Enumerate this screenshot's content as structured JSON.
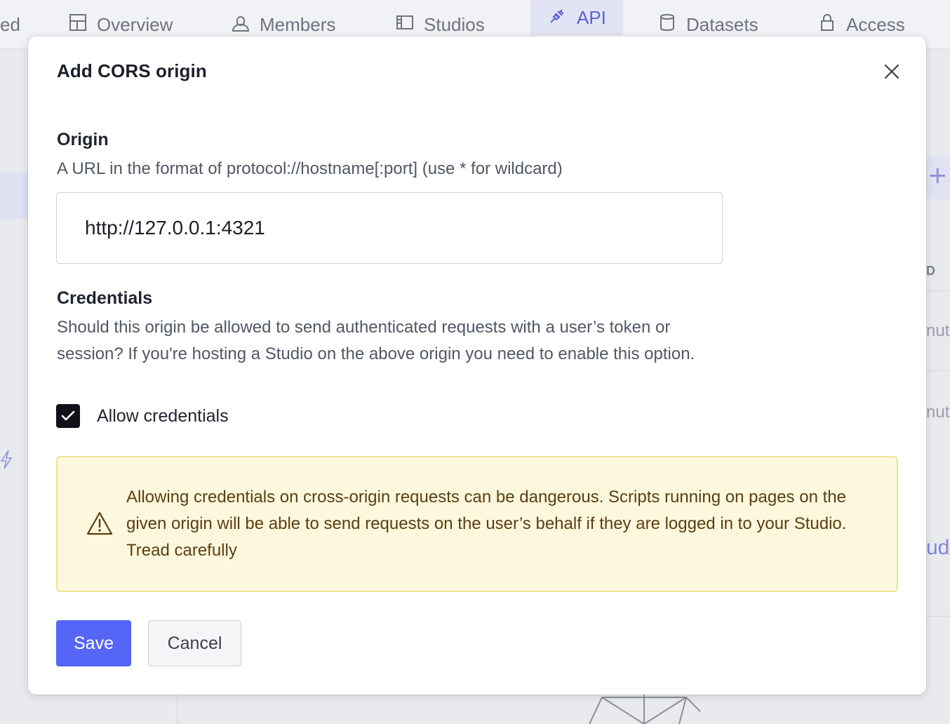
{
  "nav": {
    "tabs": [
      {
        "label": "ed",
        "icon": "none"
      },
      {
        "label": "Overview",
        "icon": "layout-icon"
      },
      {
        "label": "Members",
        "icon": "users-icon"
      },
      {
        "label": "Studios",
        "icon": "studio-icon"
      },
      {
        "label": "API",
        "icon": "plug-icon",
        "active": true
      },
      {
        "label": "Datasets",
        "icon": "database-icon"
      },
      {
        "label": "Access",
        "icon": "lock-icon"
      }
    ]
  },
  "background": {
    "right_column_header": "D",
    "right_row_1": "nute",
    "right_row_2": "nute",
    "right_link": "udi"
  },
  "modal": {
    "title": "Add CORS origin",
    "origin": {
      "label": "Origin",
      "description": "A URL in the format of protocol://hostname[:port] (use * for wildcard)",
      "value": "http://127.0.0.1:4321"
    },
    "credentials": {
      "label": "Credentials",
      "description": "Should this origin be allowed to send authenticated requests with a user’s token or session? If you're hosting a Studio on the above origin you need to enable this option.",
      "checkbox_label": "Allow credentials",
      "checked": true
    },
    "warning": {
      "icon": "warning-triangle-icon",
      "text": "Allowing credentials on cross-origin requests can be dangerous. Scripts running on pages on the given origin will be able to send requests on the user’s behalf if they are logged in to your Studio. Tread carefully"
    },
    "actions": {
      "save_label": "Save",
      "cancel_label": "Cancel"
    }
  },
  "colors": {
    "primary": "#5565f6",
    "warning_bg": "#fdf8dd",
    "warning_border": "#ede38f",
    "warning_text": "#5b3e12",
    "checkbox": "#101218"
  }
}
